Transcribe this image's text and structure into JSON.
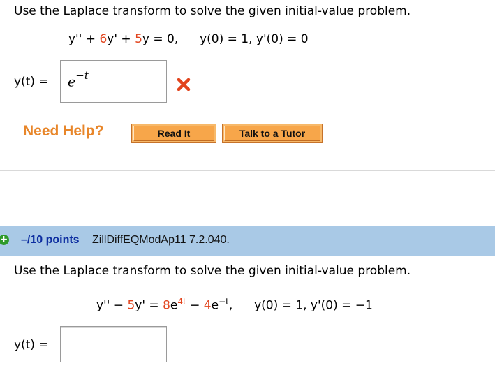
{
  "question1": {
    "prompt": "Use the Laplace transform to solve the given initial-value problem.",
    "equation": {
      "lhs_a": "y'' + ",
      "coef1": "6",
      "lhs_b": "y' + ",
      "coef2": "5",
      "lhs_c": "y = 0,",
      "conditions": "y(0) = 1,  y'(0) = 0"
    },
    "answer": {
      "label": "y(t) =",
      "value_base": "e",
      "value_exponent": "−t",
      "status_icon": "x-mark-icon",
      "status_color": "#e2441d"
    },
    "help": {
      "title": "Need Help?",
      "buttons": [
        "Read It",
        "Talk to a Tutor"
      ]
    }
  },
  "question2": {
    "header": {
      "icon": "plus-icon",
      "points": "–/10 points",
      "id": "ZillDiffEQModAp11 7.2.040."
    },
    "prompt": "Use the Laplace transform to solve the given initial-value problem.",
    "equation": {
      "part_a": "y'' − ",
      "coef1": "5",
      "part_b": "y' = ",
      "term1_coef": "8",
      "term1_base": "e",
      "term1_exp": "4t",
      "minus": " − ",
      "term2_coef": "4",
      "term2_base": "e",
      "term2_exp": "−t",
      "comma": ",",
      "conditions": "y(0) = 1, y'(0) = −1"
    },
    "answer": {
      "label": "y(t) =",
      "value": ""
    }
  },
  "colors": {
    "accent_red": "#e2441d",
    "help_orange": "#e8862a",
    "button_orange": "#f7a64a",
    "question_bar": "#a9c9e6",
    "points_blue": "#0c2da0"
  }
}
